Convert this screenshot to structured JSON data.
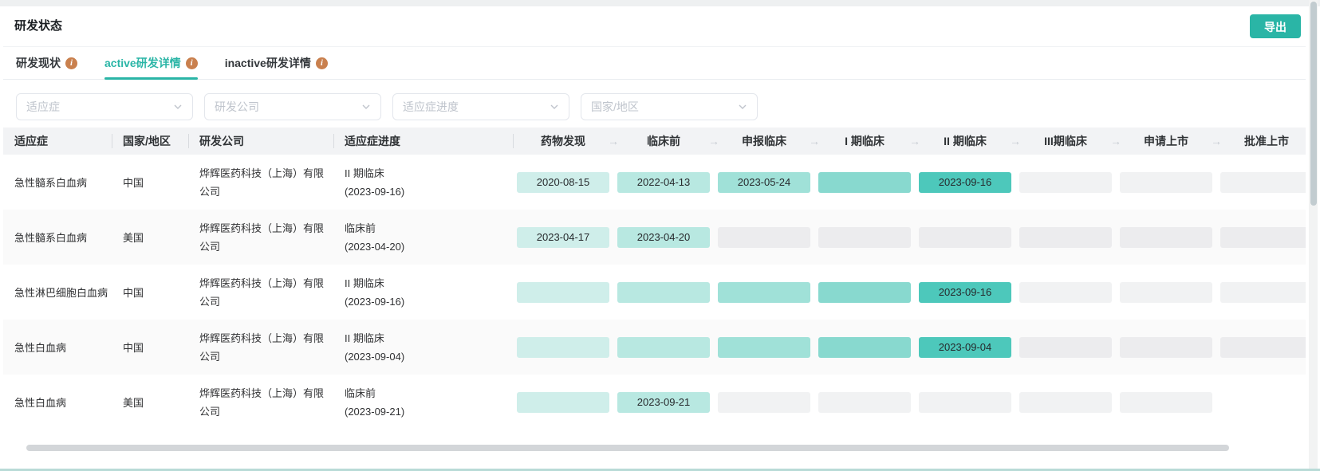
{
  "page": {
    "title": "研发状态",
    "export_label": "导出"
  },
  "tabs": [
    {
      "label": "研发现状",
      "active": false
    },
    {
      "label": "active研发详情",
      "active": true
    },
    {
      "label": "inactive研发详情",
      "active": false
    }
  ],
  "filters": [
    {
      "placeholder": "适应症"
    },
    {
      "placeholder": "研发公司"
    },
    {
      "placeholder": "适应症进度"
    },
    {
      "placeholder": "国家/地区"
    }
  ],
  "table": {
    "fixed_headers": [
      "适应症",
      "国家/地区",
      "研发公司",
      "适应症进度"
    ],
    "stage_headers": [
      "药物发现",
      "临床前",
      "申报临床",
      "I 期临床",
      "II 期临床",
      "III期临床",
      "申请上市",
      "批准上市"
    ],
    "rows": [
      {
        "indication": "急性髓系白血病",
        "region": "中国",
        "company": "烨辉医药科技（上海）有限公司",
        "progress_stage": "II 期临床",
        "progress_date": "(2023-09-16)",
        "stages": [
          {
            "state": "date",
            "label": "2020-08-15"
          },
          {
            "state": "date",
            "label": "2022-04-13"
          },
          {
            "state": "date",
            "label": "2023-05-24"
          },
          {
            "state": "filled",
            "label": ""
          },
          {
            "state": "date",
            "label": "2023-09-16"
          },
          {
            "state": "empty",
            "label": ""
          },
          {
            "state": "empty",
            "label": ""
          },
          {
            "state": "empty",
            "label": ""
          }
        ]
      },
      {
        "indication": "急性髓系白血病",
        "region": "美国",
        "company": "烨辉医药科技（上海）有限公司",
        "progress_stage": "临床前",
        "progress_date": "(2023-04-20)",
        "stages": [
          {
            "state": "date",
            "label": "2023-04-17"
          },
          {
            "state": "date",
            "label": "2023-04-20"
          },
          {
            "state": "empty",
            "label": ""
          },
          {
            "state": "empty",
            "label": ""
          },
          {
            "state": "empty",
            "label": ""
          },
          {
            "state": "empty",
            "label": ""
          },
          {
            "state": "empty",
            "label": ""
          },
          {
            "state": "empty",
            "label": ""
          }
        ]
      },
      {
        "indication": "急性淋巴细胞白血病",
        "region": "中国",
        "company": "烨辉医药科技（上海）有限公司",
        "progress_stage": "II 期临床",
        "progress_date": "(2023-09-16)",
        "stages": [
          {
            "state": "filled",
            "label": ""
          },
          {
            "state": "filled",
            "label": ""
          },
          {
            "state": "filled",
            "label": ""
          },
          {
            "state": "filled",
            "label": ""
          },
          {
            "state": "date",
            "label": "2023-09-16"
          },
          {
            "state": "empty",
            "label": ""
          },
          {
            "state": "empty",
            "label": ""
          },
          {
            "state": "empty",
            "label": ""
          }
        ]
      },
      {
        "indication": "急性白血病",
        "region": "中国",
        "company": "烨辉医药科技（上海）有限公司",
        "progress_stage": "II 期临床",
        "progress_date": "(2023-09-04)",
        "stages": [
          {
            "state": "filled",
            "label": ""
          },
          {
            "state": "filled",
            "label": ""
          },
          {
            "state": "filled",
            "label": ""
          },
          {
            "state": "filled",
            "label": ""
          },
          {
            "state": "date",
            "label": "2023-09-04"
          },
          {
            "state": "empty",
            "label": ""
          },
          {
            "state": "empty",
            "label": ""
          },
          {
            "state": "empty",
            "label": ""
          }
        ]
      },
      {
        "indication": "急性白血病",
        "region": "美国",
        "company": "烨辉医药科技（上海）有限公司",
        "progress_stage": "临床前",
        "progress_date": "(2023-09-21)",
        "stages": [
          {
            "state": "filled",
            "label": ""
          },
          {
            "state": "date",
            "label": "2023-09-21"
          },
          {
            "state": "empty",
            "label": ""
          },
          {
            "state": "empty",
            "label": ""
          },
          {
            "state": "empty",
            "label": ""
          },
          {
            "state": "empty",
            "label": ""
          },
          {
            "state": "empty",
            "label": ""
          }
        ]
      }
    ]
  },
  "icons": {
    "info": "i",
    "stage_arrow": "→",
    "select_chevron": "chevron-down-icon"
  },
  "colors": {
    "accent": "#2ab5a6",
    "info_icon": "#c9804e",
    "header_bg": "#f2f3f5",
    "zebra_bg": "#fafafa",
    "stage_scale": [
      "#cfeeea",
      "#b8e8e1",
      "#a0e1d8",
      "#88d9cf",
      "#4dc8bb",
      "#3fc0b3",
      "#31b8ab",
      "#23b0a3"
    ],
    "empty_bar": "#f1f2f3",
    "empty_bar_zebra": "#ececee"
  }
}
